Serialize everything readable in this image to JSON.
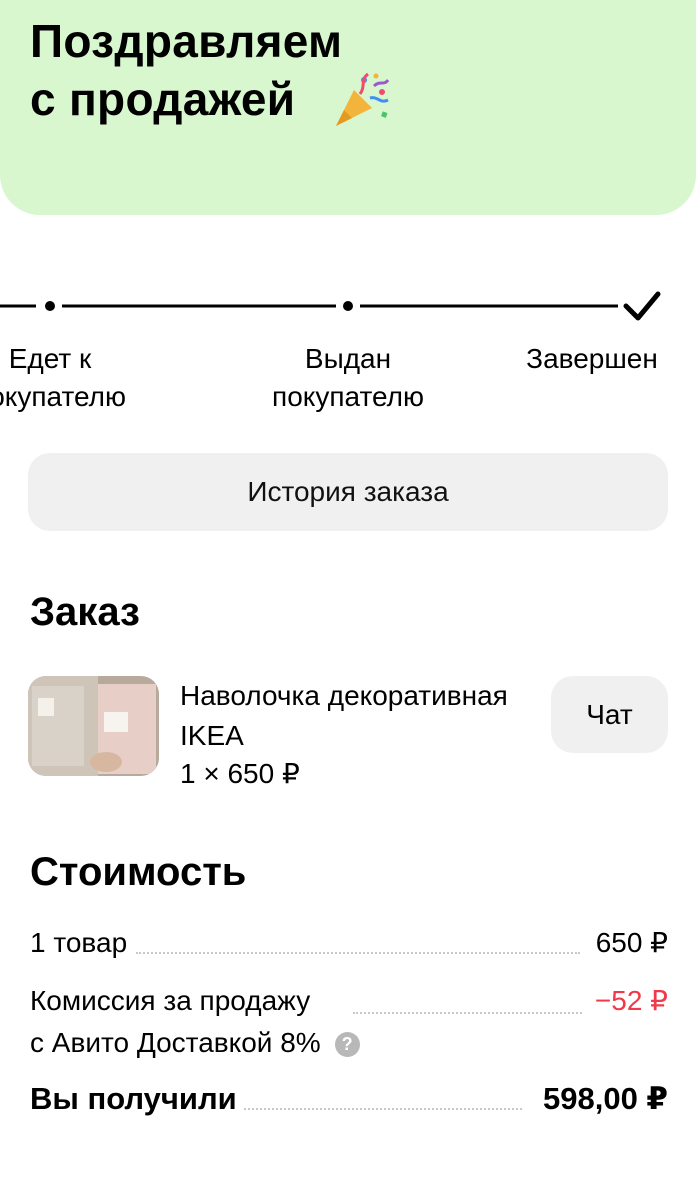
{
  "banner": {
    "title_line1": "Поздравляем",
    "title_line2": "с продажей",
    "icon": "party-popper-icon",
    "background": "#d9f7cf"
  },
  "progress": {
    "steps": [
      {
        "label": "Едет к\nпокупателю",
        "status": "done"
      },
      {
        "label": "Выдан\nпокупателю",
        "status": "done"
      },
      {
        "label": "Завершен",
        "status": "current"
      }
    ]
  },
  "history_button": {
    "label": "История заказа"
  },
  "order": {
    "title": "Заказ",
    "item": {
      "name": "Наволочка декоративная IKEA",
      "qty_price": "1 × 650 ₽"
    },
    "chat_label": "Чат"
  },
  "cost": {
    "title": "Стоимость",
    "rows": [
      {
        "label": "1 товар",
        "value": "650 ₽"
      },
      {
        "label": "Комиссия за продажу\nс Авито Доставкой 8%",
        "value": "−52 ₽",
        "color": "#f0394a"
      },
      {
        "label": "Вы получили",
        "value": "598,00 ₽"
      }
    ]
  }
}
